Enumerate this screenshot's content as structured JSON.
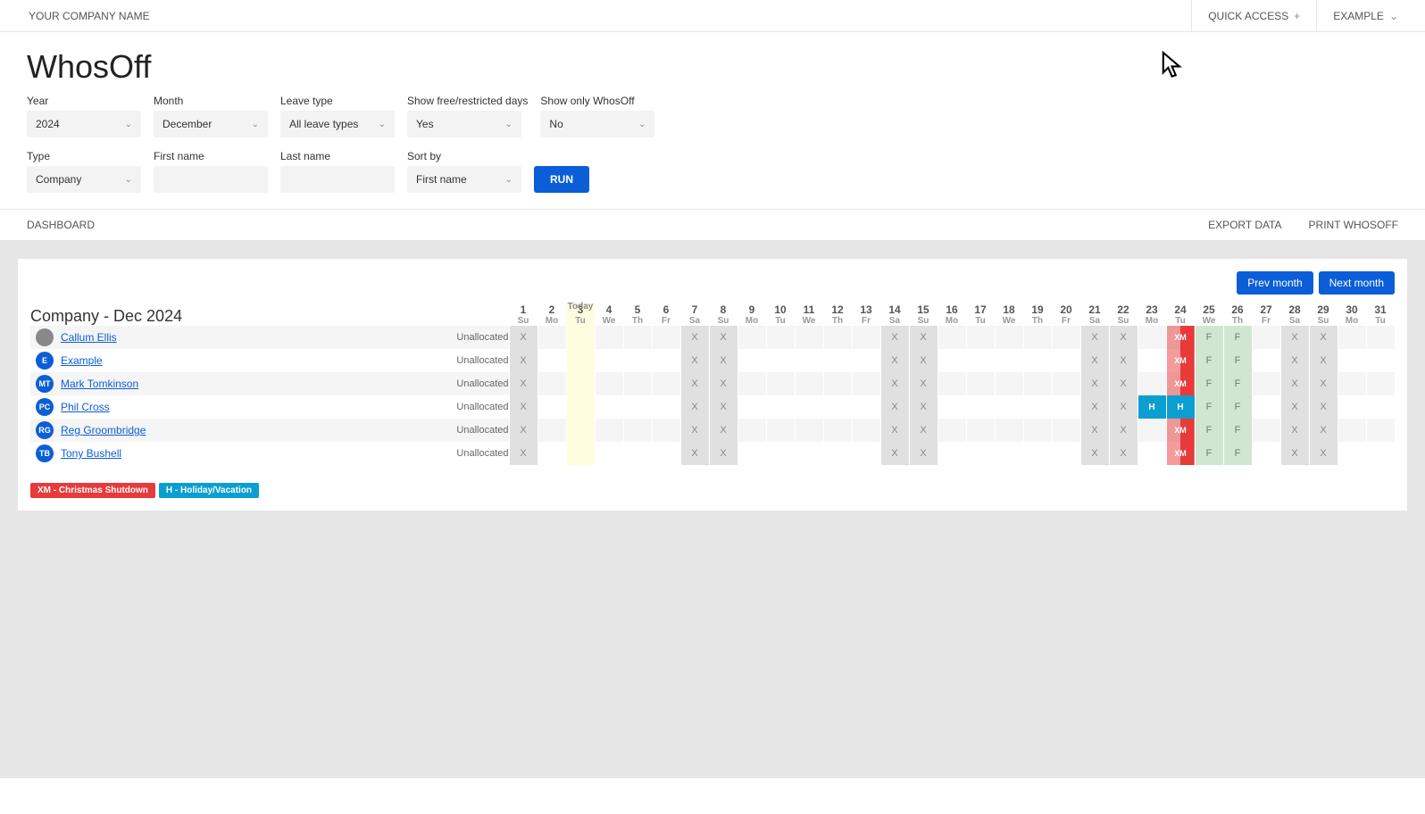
{
  "topbar": {
    "company": "YOUR COMPANY NAME",
    "quick_access": "QUICK ACCESS",
    "user": "EXAMPLE"
  },
  "page_title": "WhosOff",
  "filters": {
    "year": {
      "label": "Year",
      "value": "2024"
    },
    "month": {
      "label": "Month",
      "value": "December"
    },
    "leave_type": {
      "label": "Leave type",
      "value": "All leave types"
    },
    "show_free": {
      "label": "Show free/restricted days",
      "value": "Yes"
    },
    "show_only": {
      "label": "Show only WhosOff",
      "value": "No"
    },
    "type": {
      "label": "Type",
      "value": "Company"
    },
    "first_name": {
      "label": "First name",
      "value": ""
    },
    "last_name": {
      "label": "Last name",
      "value": ""
    },
    "sort_by": {
      "label": "Sort by",
      "value": "First name"
    },
    "run": "RUN"
  },
  "subbar": {
    "dashboard": "DASHBOARD",
    "export": "EXPORT DATA",
    "print": "PRINT WHOSOFF"
  },
  "nav": {
    "prev": "Prev month",
    "next": "Next month"
  },
  "calendar": {
    "title": "Company - Dec 2024",
    "today_label": "Today",
    "today_index": 2,
    "days": [
      {
        "n": "1",
        "d": "Su",
        "w": true
      },
      {
        "n": "2",
        "d": "Mo"
      },
      {
        "n": "3",
        "d": "Tu"
      },
      {
        "n": "4",
        "d": "We"
      },
      {
        "n": "5",
        "d": "Th"
      },
      {
        "n": "6",
        "d": "Fr"
      },
      {
        "n": "7",
        "d": "Sa",
        "w": true
      },
      {
        "n": "8",
        "d": "Su",
        "w": true
      },
      {
        "n": "9",
        "d": "Mo"
      },
      {
        "n": "10",
        "d": "Tu"
      },
      {
        "n": "11",
        "d": "We"
      },
      {
        "n": "12",
        "d": "Th"
      },
      {
        "n": "13",
        "d": "Fr"
      },
      {
        "n": "14",
        "d": "Sa",
        "w": true
      },
      {
        "n": "15",
        "d": "Su",
        "w": true
      },
      {
        "n": "16",
        "d": "Mo"
      },
      {
        "n": "17",
        "d": "Tu"
      },
      {
        "n": "18",
        "d": "We"
      },
      {
        "n": "19",
        "d": "Th"
      },
      {
        "n": "20",
        "d": "Fr"
      },
      {
        "n": "21",
        "d": "Sa",
        "w": true
      },
      {
        "n": "22",
        "d": "Su",
        "w": true
      },
      {
        "n": "23",
        "d": "Mo"
      },
      {
        "n": "24",
        "d": "Tu"
      },
      {
        "n": "25",
        "d": "We"
      },
      {
        "n": "26",
        "d": "Th"
      },
      {
        "n": "27",
        "d": "Fr"
      },
      {
        "n": "28",
        "d": "Sa",
        "w": true
      },
      {
        "n": "29",
        "d": "Su",
        "w": true
      },
      {
        "n": "30",
        "d": "Mo"
      },
      {
        "n": "31",
        "d": "Tu"
      }
    ],
    "rows": [
      {
        "name": "Callum Ellis",
        "initials": "",
        "avatarImg": true,
        "status": "Unallocated",
        "cells": {
          "0": "X",
          "6": "X",
          "7": "X",
          "13": "X",
          "14": "X",
          "20": "X",
          "21": "X",
          "23": "XM",
          "24": "F",
          "25": "F",
          "27": "X",
          "28": "X"
        }
      },
      {
        "name": "Example",
        "initials": "E",
        "status": "Unallocated",
        "cells": {
          "0": "X",
          "6": "X",
          "7": "X",
          "13": "X",
          "14": "X",
          "20": "X",
          "21": "X",
          "23": "XM",
          "24": "F",
          "25": "F",
          "27": "X",
          "28": "X"
        }
      },
      {
        "name": "Mark Tomkinson",
        "initials": "MT",
        "status": "Unallocated",
        "cells": {
          "0": "X",
          "6": "X",
          "7": "X",
          "13": "X",
          "14": "X",
          "20": "X",
          "21": "X",
          "23": "XM",
          "24": "F",
          "25": "F",
          "27": "X",
          "28": "X"
        }
      },
      {
        "name": "Phil Cross",
        "initials": "PC",
        "status": "Unallocated",
        "cells": {
          "0": "X",
          "6": "X",
          "7": "X",
          "13": "X",
          "14": "X",
          "20": "X",
          "21": "X",
          "22": "H",
          "23": "H",
          "24": "F",
          "25": "F",
          "27": "X",
          "28": "X"
        }
      },
      {
        "name": "Reg Groombridge",
        "initials": "RG",
        "status": "Unallocated",
        "cells": {
          "0": "X",
          "6": "X",
          "7": "X",
          "13": "X",
          "14": "X",
          "20": "X",
          "21": "X",
          "23": "XM",
          "24": "F",
          "25": "F",
          "27": "X",
          "28": "X"
        }
      },
      {
        "name": "Tony Bushell",
        "initials": "TB",
        "status": "Unallocated",
        "cells": {
          "0": "X",
          "6": "X",
          "7": "X",
          "13": "X",
          "14": "X",
          "20": "X",
          "21": "X",
          "23": "XM",
          "24": "F",
          "25": "F",
          "27": "X",
          "28": "X"
        }
      }
    ]
  },
  "legend": {
    "xm": "XM - Christmas Shutdown",
    "h": "H - Holiday/Vacation"
  }
}
